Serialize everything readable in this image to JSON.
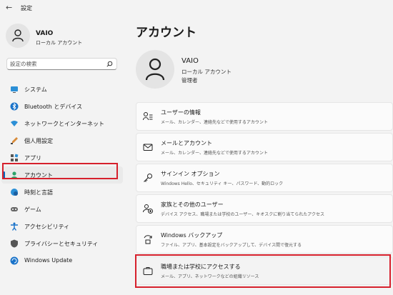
{
  "window": {
    "title": "設定",
    "back_glyph": "←"
  },
  "sidebar": {
    "profile": {
      "name": "VAIO",
      "account_type": "ローカル アカウント"
    },
    "search": {
      "placeholder": "設定の検索"
    },
    "items": [
      {
        "label": "システム",
        "icon": "system-icon"
      },
      {
        "label": "Bluetooth とデバイス",
        "icon": "bluetooth-icon"
      },
      {
        "label": "ネットワークとインターネット",
        "icon": "network-icon"
      },
      {
        "label": "個人用設定",
        "icon": "personalization-icon"
      },
      {
        "label": "アプリ",
        "icon": "apps-icon"
      },
      {
        "label": "アカウント",
        "icon": "accounts-icon",
        "selected": true
      },
      {
        "label": "時刻と言語",
        "icon": "time-language-icon"
      },
      {
        "label": "ゲーム",
        "icon": "gaming-icon"
      },
      {
        "label": "アクセシビリティ",
        "icon": "accessibility-icon"
      },
      {
        "label": "プライバシーとセキュリティ",
        "icon": "privacy-security-icon"
      },
      {
        "label": "Windows Update",
        "icon": "windows-update-icon"
      }
    ]
  },
  "main": {
    "title": "アカウント",
    "user": {
      "name": "VAIO",
      "account_type": "ローカル アカウント",
      "role": "管理者"
    },
    "cards": [
      {
        "title": "ユーザーの情報",
        "subtitle": "メール、カレンダー、連絡先などで使用するアカウント",
        "icon": "user-info-icon"
      },
      {
        "title": "メールとアカウント",
        "subtitle": "メール、カレンダー、連絡先などで使用するアカウント",
        "icon": "mail-icon"
      },
      {
        "title": "サインイン オプション",
        "subtitle": "Windows Hello、セキュリティ キー、パスワード、動的ロック",
        "icon": "key-icon"
      },
      {
        "title": "家族とその他のユーザー",
        "subtitle": "デバイス アクセス、職場または学校のユーザー、キオスクに割り当てられたアクセス",
        "icon": "family-icon"
      },
      {
        "title": "Windows バックアップ",
        "subtitle": "ファイル、アプリ、基本設定をバックアップして、デバイス間で復元する",
        "icon": "backup-icon"
      },
      {
        "title": "職場または学校にアクセスする",
        "subtitle": "メール、アプリ、ネットワークなどの組織リソース",
        "icon": "briefcase-icon"
      }
    ]
  },
  "colors": {
    "accent": "#0067c0",
    "highlight_box": "#d6202c",
    "background": "#f3f3f3"
  }
}
